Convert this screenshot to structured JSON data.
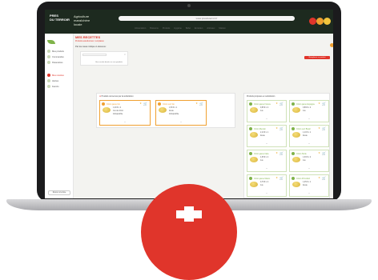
{
  "app": {
    "logo_text": "PRES\nDU TERROIR",
    "brand_sub": "Agriculture\nmaraîchère\nlocale",
    "url": "www.presduterroir.fr",
    "colors": {
      "header": "#1d2a1f",
      "accent_red": "#e0352b",
      "leaf": "#7fb34a",
      "orange": "#f0a030"
    }
  },
  "header_dots": [
    "red",
    "orange",
    "yellow"
  ],
  "nav": [
    "Alimentation",
    "Boissons",
    "Produits",
    "Hygiène",
    "Bébé",
    "Entretien",
    "Animaux",
    "Maison"
  ],
  "sidebar": {
    "items": [
      {
        "label": "Mes produits",
        "icon": "leaf-icon"
      },
      {
        "label": "Commandes",
        "icon": "list-icon"
      },
      {
        "label": "Paramètres",
        "icon": "gear-icon"
      },
      {
        "label": "Mes recettes",
        "icon": "book-icon"
      },
      {
        "label": "Alertes",
        "icon": "alert-icon"
      },
      {
        "label": "Favoris",
        "icon": "heart-icon"
      }
    ],
    "footer_button": "Retour à la liste"
  },
  "page": {
    "title": "MES RECETTES",
    "warning": "Produits sélectionnés / remplacés",
    "subtitle": "Par les cases indique ci-dessous :",
    "red_button": "Remplacer ce produit",
    "info_box": "Une recette basée sur vos produits",
    "panel_left_title": "Produits concernés par la substitution",
    "panel_right_title": "Produits proposés en substitution"
  },
  "left_cards": [
    {
      "title": "Citron jaune bio",
      "price": "1,20 €",
      "qty": "x 2",
      "label": "Jus de citron",
      "status": "Indisponible"
    },
    {
      "title": "Citron vert bio",
      "price": "1,50 €",
      "qty": "x 1",
      "label": "Zeste",
      "status": "Indisponible"
    }
  ],
  "right_cards": [
    {
      "title": "Citron jaune France",
      "price": "0,95 €",
      "qty": "x 2",
      "label": "Jus"
    },
    {
      "title": "Citron jaune Espagne",
      "price": "0,89 €",
      "qty": "x 2",
      "label": "Jus"
    },
    {
      "title": "Citron Menton",
      "price": "2,10 €",
      "qty": "x 1",
      "label": "Zeste"
    },
    {
      "title": "Citron vert Brésil",
      "price": "1,10 €",
      "qty": "x 1",
      "label": "Zeste"
    },
    {
      "title": "Citron jaune Italie",
      "price": "1,05 €",
      "qty": "x 2",
      "label": "Jus"
    },
    {
      "title": "Citron Sicile",
      "price": "1,30 €",
      "qty": "x 2",
      "label": "Jus"
    },
    {
      "title": "Citron jaune Maroc",
      "price": "0,79 €",
      "qty": "x 2",
      "label": "Jus"
    },
    {
      "title": "Citron Primofiori",
      "price": "1,25 €",
      "qty": "x 1",
      "label": "Zeste"
    }
  ]
}
